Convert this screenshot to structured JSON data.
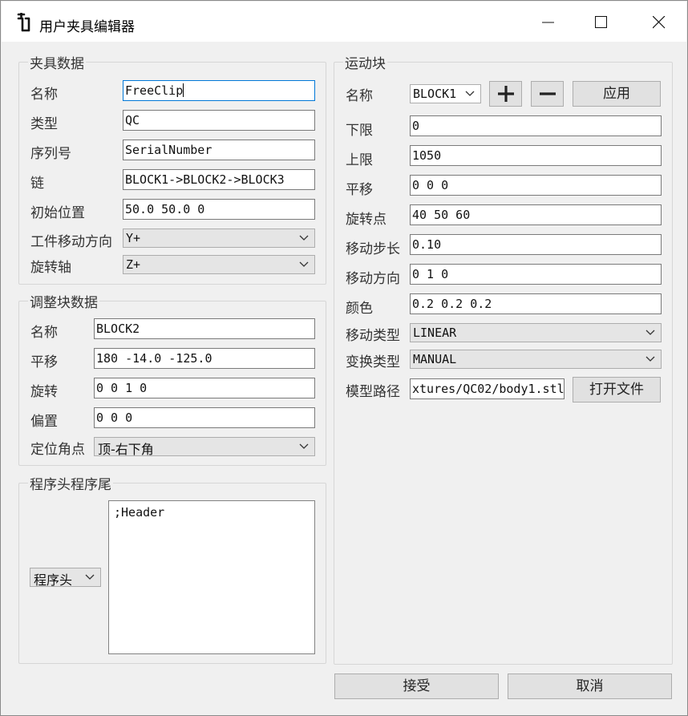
{
  "window": {
    "title": "用户夹具编辑器",
    "icons": {
      "app": "clip-app-icon",
      "minimize": "minimize-icon",
      "maximize": "maximize-icon",
      "close": "close-icon"
    }
  },
  "fixture": {
    "group_title": "夹具数据",
    "name_label": "名称",
    "name_value": "FreeClip",
    "type_label": "类型",
    "type_value": "QC",
    "serial_label": "序列号",
    "serial_value": "SerialNumber",
    "chain_label": "链",
    "chain_value": "BLOCK1->BLOCK2->BLOCK3",
    "init_pos_label": "初始位置",
    "init_pos_value": "50.0 50.0 0",
    "move_dir_label": "工件移动方向",
    "move_dir_value": "Y+",
    "rot_axis_label": "旋转轴",
    "rot_axis_value": "Z+"
  },
  "adjust": {
    "group_title": "调整块数据",
    "name_label": "名称",
    "name_value": "BLOCK2",
    "translate_label": "平移",
    "translate_value": "180 -14.0 -125.0",
    "rotate_label": "旋转",
    "rotate_value": "0 0 1 0",
    "offset_label": "偏置",
    "offset_value": "0 0 0",
    "corner_label": "定位角点",
    "corner_value": "顶-右下角"
  },
  "program": {
    "group_title": "程序头程序尾",
    "selector_value": "程序头",
    "text": ";Header"
  },
  "motion": {
    "group_title": "运动块",
    "name_label": "名称",
    "name_value": "BLOCK1",
    "add_icon": "plus-icon",
    "remove_icon": "minus-icon",
    "apply_label": "应用",
    "lower_label": "下限",
    "lower_value": "0",
    "upper_label": "上限",
    "upper_value": "1050",
    "translate_label": "平移",
    "translate_value": "0 0 0",
    "pivot_label": "旋转点",
    "pivot_value": "40 50 60",
    "step_label": "移动步长",
    "step_value": "0.10",
    "direction_label": "移动方向",
    "direction_value": "0 1 0",
    "color_label": "颜色",
    "color_value": "0.2 0.2 0.2",
    "move_type_label": "移动类型",
    "move_type_value": "LINEAR",
    "transform_type_label": "变换类型",
    "transform_type_value": "MANUAL",
    "model_path_label": "模型路径",
    "model_path_value": "xtures/QC02/body1.stl",
    "open_file_label": "打开文件"
  },
  "footer": {
    "accept_label": "接受",
    "cancel_label": "取消"
  },
  "colors": {
    "focus_border": "#0078d7",
    "window_bg": "#f0f0f0",
    "button_bg": "#e1e1e1"
  }
}
